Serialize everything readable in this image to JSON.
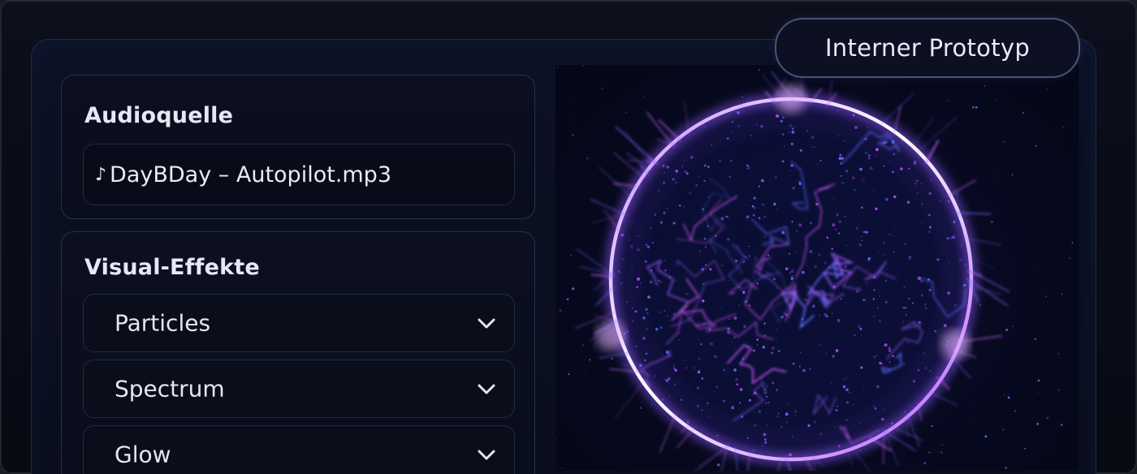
{
  "badge": {
    "label": "Interner Prototyp"
  },
  "audio_panel": {
    "title": "Audioquelle",
    "file_icon": "music-note-icon",
    "file_name": "DayBDay – Autopilot.mp3"
  },
  "effects_panel": {
    "title": "Visual-Effekte",
    "dropdowns": [
      {
        "label": "Particles",
        "icon": "chevron-down-icon"
      },
      {
        "label": "Spectrum",
        "icon": "chevron-down-icon"
      },
      {
        "label": "Glow",
        "icon": "chevron-down-icon"
      }
    ]
  },
  "visualizer": {
    "type": "glowing-particle-sphere",
    "colors": [
      "#7a5cff",
      "#c04dff",
      "#4f7bff"
    ]
  }
}
